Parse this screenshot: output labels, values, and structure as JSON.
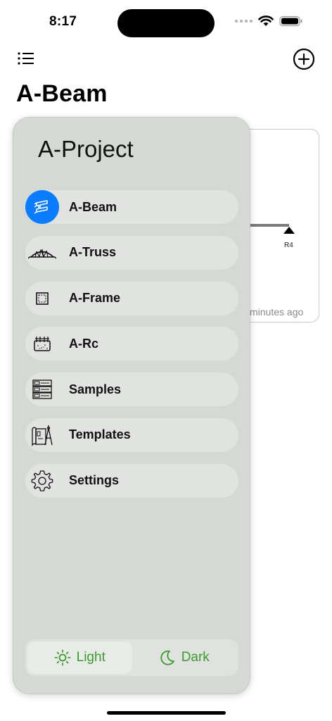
{
  "status_bar": {
    "time": "8:17"
  },
  "header": {
    "title": "A-Beam"
  },
  "background_card": {
    "support_label": "R4",
    "time_ago": "minutes ago"
  },
  "drawer": {
    "title": "A-Project",
    "items": [
      {
        "label": "A-Beam",
        "icon": "beam-icon",
        "active": true
      },
      {
        "label": "A-Truss",
        "icon": "truss-icon"
      },
      {
        "label": "A-Frame",
        "icon": "frame-icon"
      },
      {
        "label": "A-Rc",
        "icon": "rc-icon"
      },
      {
        "label": "Samples",
        "icon": "samples-icon"
      },
      {
        "label": "Templates",
        "icon": "templates-icon"
      },
      {
        "label": "Settings",
        "icon": "gear-icon"
      }
    ],
    "theme": {
      "light_label": "Light",
      "dark_label": "Dark",
      "selected": "Light",
      "accent_color": "#3c9a2e"
    }
  },
  "colors": {
    "active_item": "#0a7cff",
    "drawer_bg": "#d5d9d4"
  }
}
